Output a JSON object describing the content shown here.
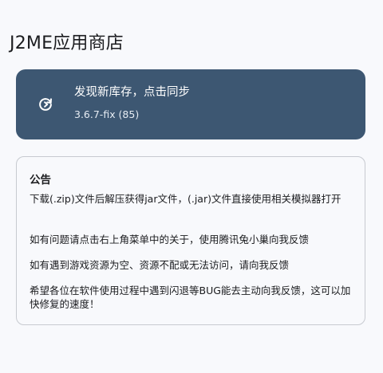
{
  "app": {
    "title": "J2ME应用商店"
  },
  "sync_card": {
    "title": "发现新库存，点击同步",
    "version": "3.6.7-fix (85)",
    "icon": "sync-icon",
    "background_color": "#3d5772"
  },
  "notice": {
    "heading": "公告",
    "lines": [
      "下载(.zip)文件后解压获得jar文件，(.jar)文件直接使用相关模拟器打开",
      "如有问题请点击右上角菜单中的关于，使用腾讯兔小巢向我反馈",
      "如有遇到游戏资源为空、资源不配或无法访问，请向我反馈",
      "希望各位在软件使用过程中遇到闪退等BUG能去主动向我反馈，这可以加快修复的速度！"
    ]
  }
}
